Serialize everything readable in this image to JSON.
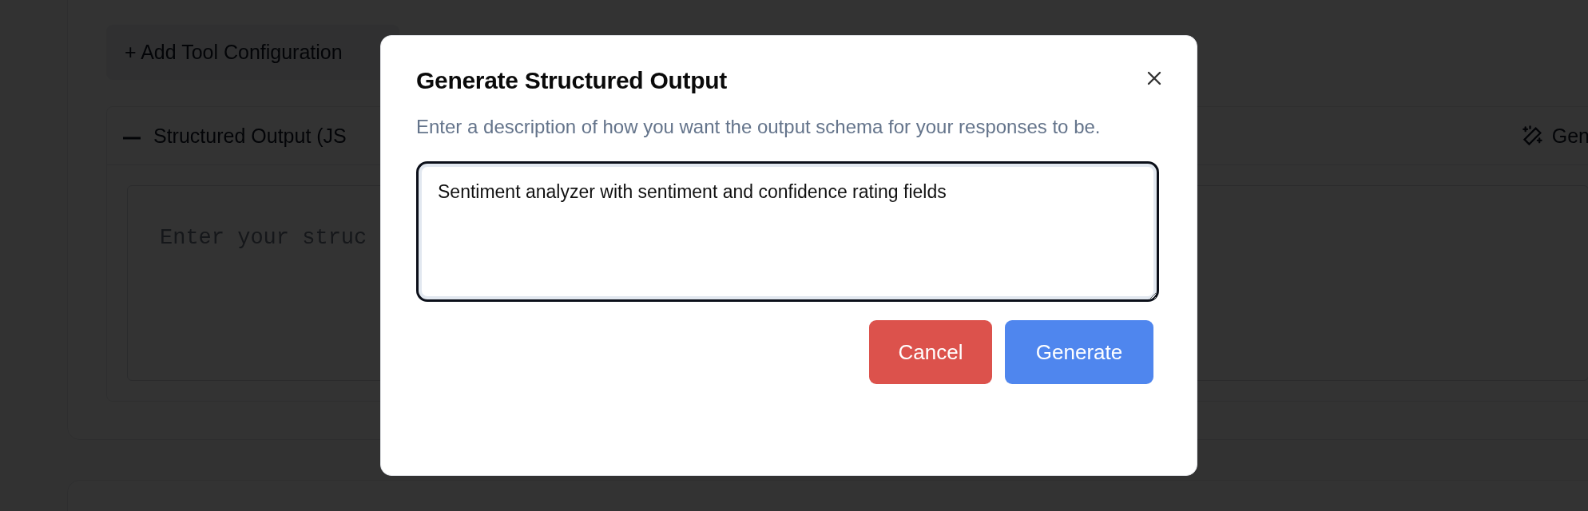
{
  "background": {
    "add_tool_button": "+ Add Tool Configuration",
    "structured_output_panel": {
      "expanded": true,
      "title": "Structured Output (JS",
      "generate_button": "Gen",
      "editor_placeholder": "Enter your struc"
    }
  },
  "dialog": {
    "title": "Generate Structured Output",
    "description": "Enter a description of how you want the output schema for your responses to be.",
    "description_field": {
      "value": "Sentiment analyzer with sentiment and confidence rating fields"
    },
    "buttons": [
      {
        "label": "Cancel",
        "kind": "cancel"
      },
      {
        "label": "Generate",
        "kind": "primary"
      }
    ]
  }
}
